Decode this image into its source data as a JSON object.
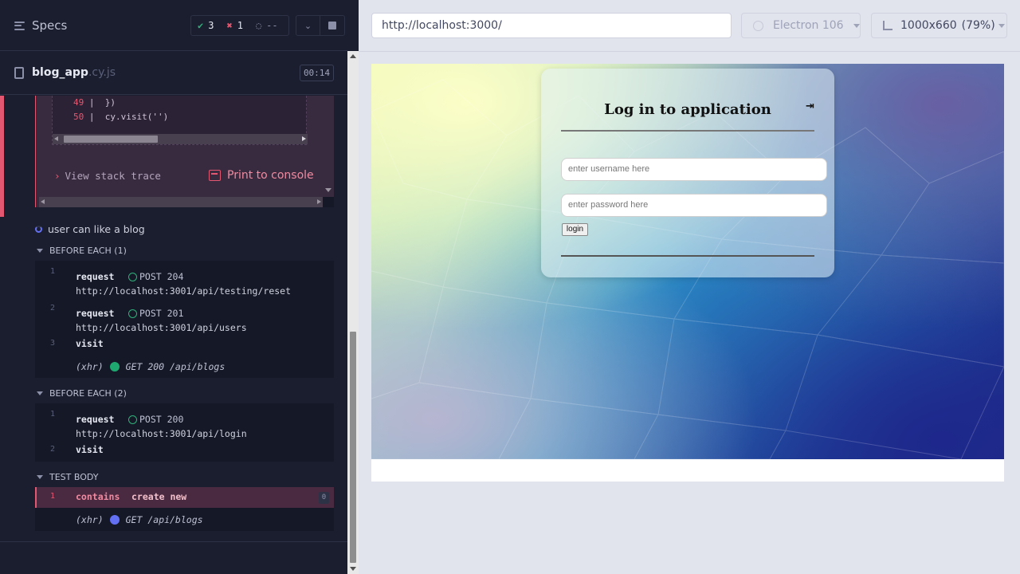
{
  "reporter": {
    "specs_label": "Specs",
    "stats": {
      "passed": "3",
      "failed": "1",
      "pending": "--"
    },
    "file": {
      "name": "blog_app",
      "ext": ".cy.js",
      "duration": "00:14"
    },
    "error": {
      "code_lines": [
        {
          "num": "49",
          "text": "  })"
        },
        {
          "num": "50",
          "text": "  cy.visit('')"
        }
      ],
      "stack_trace_label": "View stack trace",
      "print_label": "Print to console"
    },
    "test": {
      "title": "user can like a blog",
      "hooks": [
        {
          "title": "BEFORE EACH (1)",
          "commands": [
            {
              "num": "1",
              "name": "request",
              "meta": "POST 204",
              "url": "http://localhost:3001/api/testing/reset"
            },
            {
              "num": "2",
              "name": "request",
              "meta": "POST 201",
              "url": "http://localhost:3001/api/users"
            },
            {
              "num": "3",
              "name": "visit"
            }
          ],
          "xhr": {
            "label": "(xhr)",
            "text": "GET 200 /api/blogs",
            "color": "#1fa971"
          }
        },
        {
          "title": "BEFORE EACH (2)",
          "commands": [
            {
              "num": "1",
              "name": "request",
              "meta": "POST 200",
              "url": "http://localhost:3001/api/login"
            },
            {
              "num": "2",
              "name": "visit"
            }
          ]
        },
        {
          "title": "TEST BODY",
          "commands": [
            {
              "num": "1",
              "name": "contains",
              "arg": "create new",
              "badge": "0"
            }
          ],
          "xhr": {
            "label": "(xhr)",
            "text": "GET /api/blogs",
            "color": "#6470f3"
          }
        }
      ]
    }
  },
  "browser_bar": {
    "url": "http://localhost:3000/",
    "browser": "Electron 106",
    "viewport": "1000x660",
    "zoom": "(79%)"
  },
  "app": {
    "title": "Log in to application",
    "username_placeholder": "enter username here",
    "password_placeholder": "enter password here",
    "login_label": "login",
    "signin_icon": "sign-in-icon"
  }
}
